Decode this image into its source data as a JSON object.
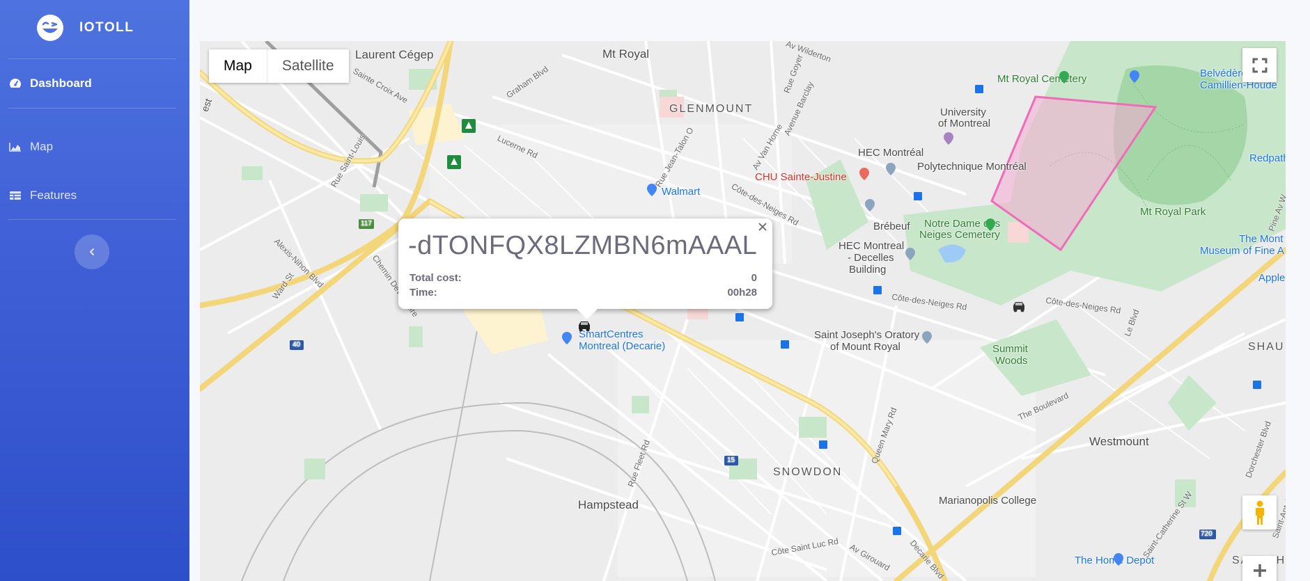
{
  "brand": {
    "name": "IOTOLL"
  },
  "sidebar": {
    "items": [
      {
        "label": "Dashboard",
        "icon": "gauge-icon"
      },
      {
        "label": "Map",
        "icon": "area-chart-icon"
      },
      {
        "label": "Features",
        "icon": "table-icon"
      }
    ],
    "collapse_icon": "chevron-left-icon"
  },
  "map": {
    "type_buttons": {
      "map": "Map",
      "satellite": "Satellite"
    },
    "labels": {
      "mt_royal": "Mt Royal",
      "glenmount": "GLENMOUNT",
      "laurent_cegep": "Laurent Cégep",
      "sainte_croix": "Sainte Croix Ave",
      "graham": "Graham Blvd",
      "lucerne": "Lucerne Rd",
      "rue_saint_louis": "Rue Saint-Louis",
      "alexis_nihon": "Alexis-Nihon Blvd",
      "ward": "Ward St",
      "chemin_devonshire": "Chemin Devonshire",
      "walmart": "Walmart",
      "chu": "CHU Sainte-Justine",
      "hec": "HEC Montréal",
      "hec_decelles_1": "HEC Montreal",
      "hec_decelles_2": "- Decelles",
      "hec_decelles_3": "Building",
      "poly": "Polytechnique Montréal",
      "univ_1": "University",
      "univ_2": "of Montreal",
      "cemetery": "Mt Royal Cemetery",
      "brebeuf": "Brébeuf",
      "notre_dame_1": "Notre Dame des",
      "notre_dame_2": "Neiges Cemetery",
      "mt_royal_park": "Mt Royal Park",
      "belvedere_1": "Belvédère",
      "belvedere_2": "Camillien-Houde",
      "redpath": "Redpath M",
      "museum_1": "The Mont",
      "museum_2": "Museum of Fine A",
      "apple": "Apple",
      "cote_neiges_1": "Côte-des-Neiges Rd",
      "cote_neiges_2": "Côte-des-Neiges Rd",
      "cote_neiges_3": "Côte-des-Neiges Rd",
      "saint_joseph_1": "Saint Joseph's Oratory",
      "saint_joseph_2": "of Mount Royal",
      "summit_1": "Summit",
      "summit_2": "Woods",
      "smartcentres_1": "SmartCentres",
      "smartcentres_2": "Montreal (Decarie)",
      "snowdon": "SNOWDON",
      "hampstead": "Hampstead",
      "westmount": "Westmount",
      "marianopolis": "Marianopolis College",
      "home_depot": "The Home Depot",
      "boulevard": "The Boulevard",
      "queen_mary": "Queen Mary Rd",
      "rue_fleet": "Rue Fleet Rd",
      "jean_talon": "Rue Jean-Talon O",
      "van_horne": "Av Van Horne",
      "barclay": "Avenue Barclay",
      "goyer": "Rue Goyer",
      "wilderton": "Av Wilderton",
      "decarie": "Decarie Blvd",
      "girouard": "Av Girouard",
      "cote_saint_luc": "Côte Saint Luc Rd",
      "le_blvd": "Le Blvd",
      "dorchester": "Dorchester Blvd",
      "pine": "Pine Av W",
      "saint_catherine": "Saint-Catherine St W",
      "saint_antoine": "Saint-Antoine S",
      "shau": "SHAU",
      "saint_h": "SAINT-H",
      "west": "est",
      "hwy_117": "117",
      "hwy_40": "40",
      "hwy_15": "15",
      "hwy_720": "720"
    },
    "info_window": {
      "title": "-dTONFQX8LZMBN6mAAAL",
      "rows": [
        {
          "label": "Total cost:",
          "value": "0"
        },
        {
          "label": "Time:",
          "value": "00h28"
        }
      ]
    },
    "polygon_color": "#f06bb8",
    "accent_color": "#4e73df"
  }
}
